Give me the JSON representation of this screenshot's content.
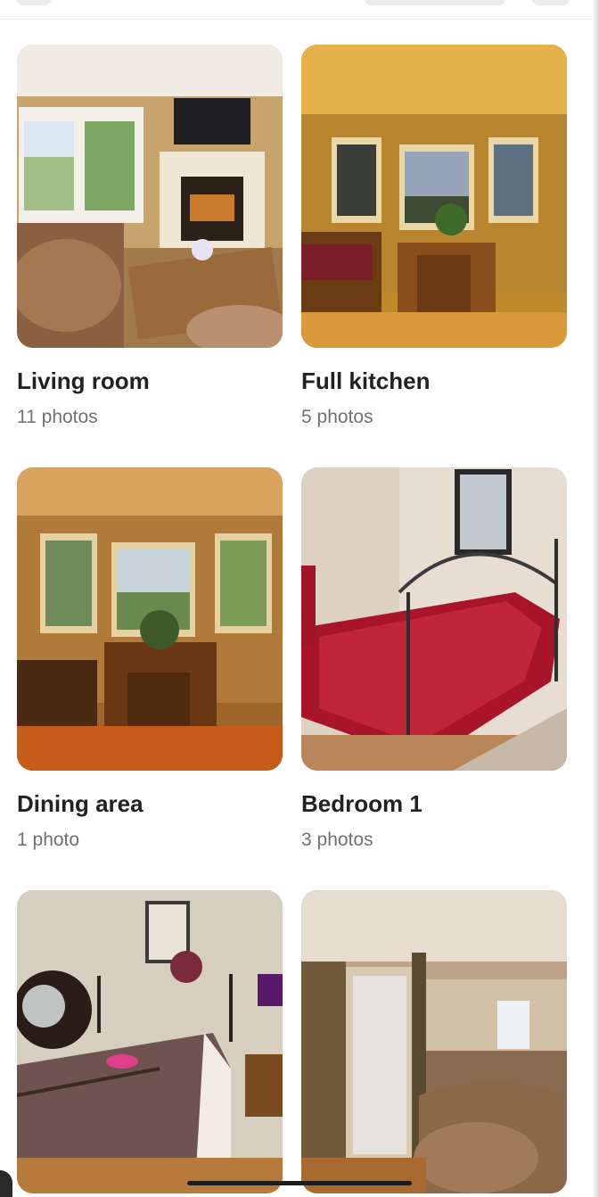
{
  "screen": {
    "title": ""
  },
  "rooms": [
    {
      "name": "Living room",
      "count": "11 photos",
      "photo_icon": "living-room-photo"
    },
    {
      "name": "Full kitchen",
      "count": "5 photos",
      "photo_icon": "kitchen-photo"
    },
    {
      "name": "Dining area",
      "count": "1 photo",
      "photo_icon": "dining-area-photo"
    },
    {
      "name": "Bedroom 1",
      "count": "3 photos",
      "photo_icon": "bedroom-photo"
    },
    {
      "name": "",
      "count": "",
      "photo_icon": "bedroom-2-photo"
    },
    {
      "name": "",
      "count": "",
      "photo_icon": "hallway-photo"
    }
  ],
  "colors": {
    "title_text": "#222222",
    "count_text": "#717171",
    "background": "#ffffff"
  }
}
